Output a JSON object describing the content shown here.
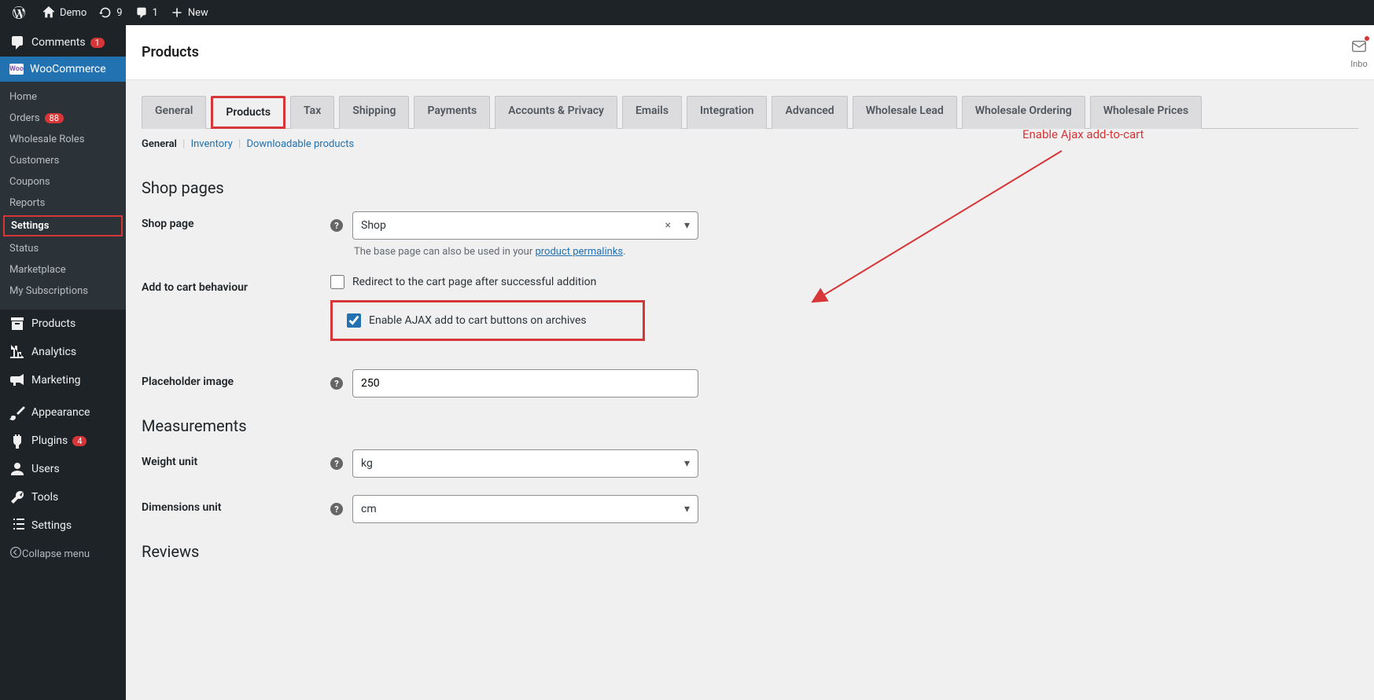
{
  "adminbar": {
    "site_name": "Demo",
    "updates_count": "9",
    "comments_count": "1",
    "new_label": "New",
    "comments_label": "Comments",
    "comments_badge": "1"
  },
  "sidebar": {
    "woocommerce": "WooCommerce",
    "submenu": [
      {
        "label": "Home"
      },
      {
        "label": "Orders",
        "badge": "88"
      },
      {
        "label": "Wholesale Roles"
      },
      {
        "label": "Customers"
      },
      {
        "label": "Coupons"
      },
      {
        "label": "Reports"
      },
      {
        "label": "Settings",
        "current": true,
        "highlight": true
      },
      {
        "label": "Status"
      },
      {
        "label": "Marketplace"
      },
      {
        "label": "My Subscriptions"
      }
    ],
    "products": "Products",
    "analytics": "Analytics",
    "marketing": "Marketing",
    "appearance": "Appearance",
    "plugins": "Plugins",
    "plugins_badge": "4",
    "users": "Users",
    "tools": "Tools",
    "settings": "Settings",
    "collapse": "Collapse menu"
  },
  "page": {
    "title": "Products",
    "inbox": "Inbo"
  },
  "tabs": [
    {
      "label": "General"
    },
    {
      "label": "Products",
      "active": true,
      "highlight": true
    },
    {
      "label": "Tax"
    },
    {
      "label": "Shipping"
    },
    {
      "label": "Payments"
    },
    {
      "label": "Accounts & Privacy"
    },
    {
      "label": "Emails"
    },
    {
      "label": "Integration"
    },
    {
      "label": "Advanced"
    },
    {
      "label": "Wholesale Lead"
    },
    {
      "label": "Wholesale Ordering"
    },
    {
      "label": "Wholesale Prices"
    }
  ],
  "subtabs": {
    "general": "General",
    "inventory": "Inventory",
    "downloadable": "Downloadable products"
  },
  "sections": {
    "shop_pages": "Shop pages",
    "measurements": "Measurements",
    "reviews": "Reviews"
  },
  "fields": {
    "shop_page": {
      "label": "Shop page",
      "value": "Shop",
      "desc_pre": "The base page can also be used in your ",
      "desc_link": "product permalinks",
      "desc_post": "."
    },
    "add_to_cart": {
      "label": "Add to cart behaviour",
      "redirect": "Redirect to the cart page after successful addition",
      "ajax": "Enable AJAX add to cart buttons on archives"
    },
    "placeholder_image": {
      "label": "Placeholder image",
      "value": "250"
    },
    "weight_unit": {
      "label": "Weight unit",
      "value": "kg"
    },
    "dimensions_unit": {
      "label": "Dimensions unit",
      "value": "cm"
    }
  },
  "annotation": {
    "text": "Enable Ajax add-to-cart"
  }
}
